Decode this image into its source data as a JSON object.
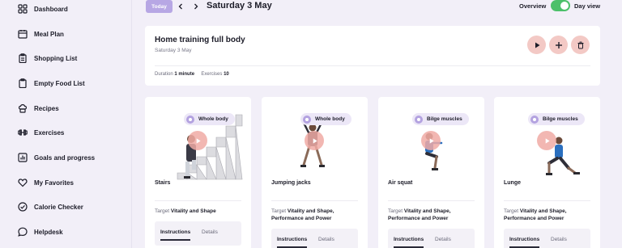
{
  "sidebar": {
    "items": [
      {
        "label": "Dashboard",
        "icon": "grid-icon"
      },
      {
        "label": "Meal Plan",
        "icon": "calendar-icon"
      },
      {
        "label": "Shopping List",
        "icon": "clipboard-list-icon"
      },
      {
        "label": "Empty Food List",
        "icon": "clipboard-icon"
      },
      {
        "label": "Recipes",
        "icon": "chef-icon"
      },
      {
        "label": "Exercises",
        "icon": "dumbbell-icon"
      },
      {
        "label": "Goals and progress",
        "icon": "chart-icon"
      },
      {
        "label": "My Favorites",
        "icon": "heart-icon"
      },
      {
        "label": "Calorie Checker",
        "icon": "check-circle-icon"
      },
      {
        "label": "Helpdesk",
        "icon": "chat-icon"
      }
    ]
  },
  "topbar": {
    "today_label": "Today",
    "date_title": "Saturday 3 May",
    "overview_label": "Overview",
    "dayview_label": "Day view",
    "toggle_on": true
  },
  "workout": {
    "title": "Home training full body",
    "date": "Saturday 3 May",
    "duration_label": "Duration",
    "duration_value": "1 minute",
    "exercises_label": "Exercises",
    "exercises_value": "10"
  },
  "exercises": [
    {
      "name": "Stairs",
      "badge": "Whole body",
      "target_label": "Target",
      "target": "Vitality and Shape",
      "tab_instructions": "Instructions",
      "tab_details": "Details"
    },
    {
      "name": "Jumping jacks",
      "badge": "Whole body",
      "target_label": "Target",
      "target": "Vitality and Shape, Performance and Power",
      "tab_instructions": "Instructions",
      "tab_details": "Details"
    },
    {
      "name": "Air squat",
      "badge": "Bilge muscles",
      "target_label": "Target",
      "target": "Vitality and Shape, Performance and Power",
      "tab_instructions": "Instructions",
      "tab_details": "Details"
    },
    {
      "name": "Lunge",
      "badge": "Bilge muscles",
      "target_label": "Target",
      "target": "Vitality and Shape, Performance and Power",
      "tab_instructions": "Instructions",
      "tab_details": "Details"
    }
  ],
  "colors": {
    "accent": "#b7a7e4",
    "toggle": "#4cc06a",
    "action_button": "#f3c9c5",
    "background": "#f2eff8"
  }
}
